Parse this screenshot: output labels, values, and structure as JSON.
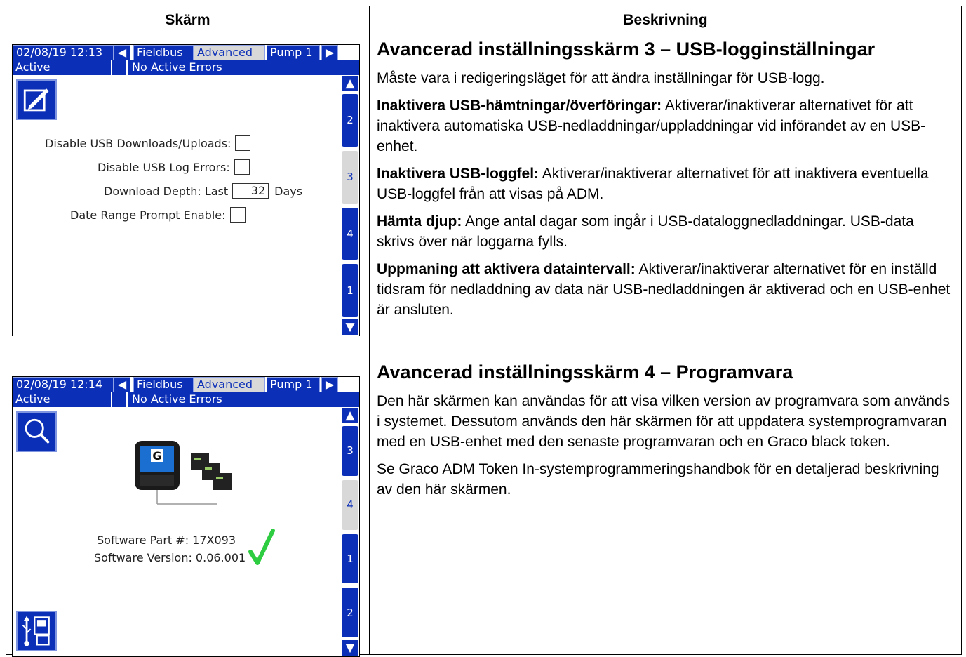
{
  "table": {
    "header_screen": "Skärm",
    "header_description": "Beskrivning"
  },
  "screen1": {
    "datetime": "02/08/19 12:13",
    "tab_fieldbus": "Fieldbus",
    "tab_advanced": "Advanced",
    "tab_pump": "Pump 1",
    "status": "Active",
    "errors": "No Active Errors",
    "pages": [
      "2",
      "3",
      "4",
      "1"
    ],
    "selected_page": "3",
    "disable_usb_label": "Disable USB Downloads/Uploads:",
    "disable_log_errors_label": "Disable USB Log Errors:",
    "download_depth_label": "Download Depth: Last",
    "download_depth_value": "32",
    "download_depth_unit": "Days",
    "date_range_label": "Date Range Prompt Enable:"
  },
  "screen2": {
    "datetime": "02/08/19 12:14",
    "tab_fieldbus": "Fieldbus",
    "tab_advanced": "Advanced",
    "tab_pump": "Pump 1",
    "status": "Active",
    "errors": "No Active Errors",
    "pages": [
      "3",
      "4",
      "1",
      "2"
    ],
    "selected_page": "4",
    "part_label": "Software Part #: 17X093",
    "version_label": "Software Version: 0.06.001",
    "colors": {
      "accent": "#0c2fb8",
      "check": "#2ecc40"
    }
  },
  "desc1": {
    "title": "Avancerad inställningsskärm 3 – USB-logginställningar",
    "intro": "Måste vara i redigeringsläget för att ändra inställningar för USB-logg.",
    "item1_term": "Inaktivera USB-hämtningar/överföringar:",
    "item1_text": " Aktiverar/inaktiverar alternativet för att inaktivera automatiska USB-nedladdningar/uppladdningar vid införandet av en USB-enhet.",
    "item2_term": "Inaktivera USB-loggfel:",
    "item2_text": " Aktiverar/inaktiverar alternativet för att inaktivera eventuella USB-loggfel från att visas på ADM.",
    "item3_term": "Hämta djup:",
    "item3_text": " Ange antal dagar som ingår i USB-dataloggnedladdningar. USB-data skrivs över när loggarna fylls.",
    "item4_term": "Uppmaning att aktivera dataintervall:",
    "item4_text": " Aktiverar/inaktiverar alternativet för en inställd tidsram för nedladdning av data när USB-nedladdningen är aktiverad och en USB-enhet är ansluten."
  },
  "desc2": {
    "title": "Avancerad inställningsskärm 4 – Programvara",
    "para1": "Den här skärmen kan användas för att visa vilken version av programvara som används i systemet. Dessutom används den här skärmen för att uppdatera systemprogramvaran med en USB-enhet med den senaste programvaran och en Graco black token.",
    "para2": "Se Graco ADM Token In-systemprogrammeringshandbok för en detaljerad beskrivning av den här skärmen."
  }
}
